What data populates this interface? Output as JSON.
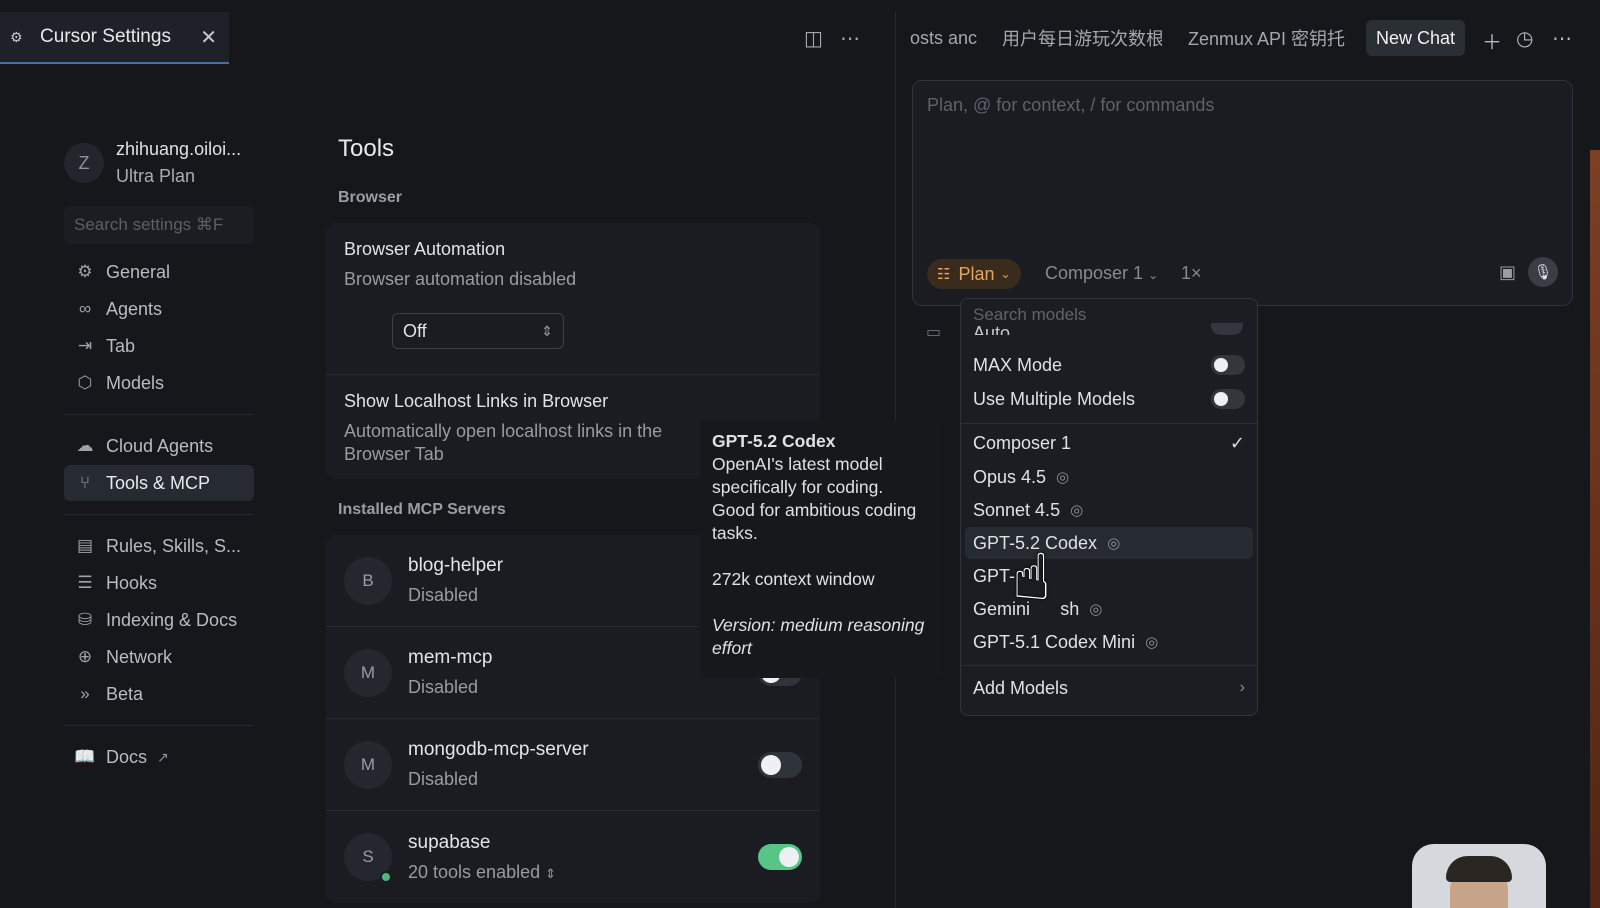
{
  "settings_tab": {
    "title": "Cursor Settings"
  },
  "user": {
    "initial": "Z",
    "name": "zhihuang.oiloi...",
    "plan": "Ultra Plan"
  },
  "search": {
    "placeholder": "Search settings ⌘F"
  },
  "nav": {
    "group1": [
      {
        "label": "General",
        "icon": "gear-icon"
      },
      {
        "label": "Agents",
        "icon": "infinity-icon"
      },
      {
        "label": "Tab",
        "icon": "tab-arrow-icon"
      },
      {
        "label": "Models",
        "icon": "cube-icon"
      }
    ],
    "group2": [
      {
        "label": "Cloud Agents",
        "icon": "cloud-icon"
      },
      {
        "label": "Tools & MCP",
        "icon": "tools-icon",
        "active": true
      }
    ],
    "group3": [
      {
        "label": "Rules, Skills, S...",
        "icon": "clipboard-icon"
      },
      {
        "label": "Hooks",
        "icon": "list-icon"
      },
      {
        "label": "Indexing & Docs",
        "icon": "database-icon"
      },
      {
        "label": "Network",
        "icon": "globe-icon"
      },
      {
        "label": "Beta",
        "icon": "chevrons-icon"
      }
    ],
    "group4": [
      {
        "label": "Docs",
        "icon": "book-icon"
      }
    ]
  },
  "main": {
    "title": "Tools",
    "browser_section": "Browser",
    "browser_automation": {
      "title": "Browser Automation",
      "subtitle": "Browser automation disabled",
      "select_value": "Off"
    },
    "localhost": {
      "title": "Show Localhost Links in Browser",
      "subtitle": "Automatically open localhost links in the Browser Tab"
    },
    "mcp_section": "Installed MCP Servers",
    "mcp_servers": [
      {
        "initial": "B",
        "name": "blog-helper",
        "status": "Disabled",
        "enabled": false
      },
      {
        "initial": "M",
        "name": "mem-mcp",
        "status": "Disabled",
        "enabled": false
      },
      {
        "initial": "M",
        "name": "mongodb-mcp-server",
        "status": "Disabled",
        "enabled": false
      },
      {
        "initial": "S",
        "name": "supabase",
        "status": "20 tools enabled",
        "enabled": true
      }
    ]
  },
  "tooltip": {
    "title": "GPT-5.2 Codex",
    "description": "OpenAI's latest model specifically for coding. Good for ambitious coding tasks.",
    "context": "272k context window",
    "version": "Version: medium reasoning effort"
  },
  "chat": {
    "tabs": [
      "osts anc",
      "用户每日游玩次数根",
      "Zenmux API 密钥托",
      "New Chat"
    ],
    "placeholder": "Plan, @ for context, / for commands",
    "mode": "Plan",
    "model": "Composer 1",
    "speed": "1×"
  },
  "dropdown": {
    "search_placeholder": "Search models",
    "cut_item": "Auto",
    "toggles": [
      {
        "label": "MAX Mode",
        "on": false
      },
      {
        "label": "Use Multiple Models",
        "on": false
      }
    ],
    "models": [
      {
        "label": "Composer 1",
        "selected": true,
        "thinking": false
      },
      {
        "label": "Opus 4.5",
        "thinking": true
      },
      {
        "label": "Sonnet 4.5",
        "thinking": true
      },
      {
        "label": "GPT-5.2 Codex",
        "thinking": true,
        "hover": true
      },
      {
        "label": "GPT-",
        "thinking": false
      },
      {
        "label": "Gemini        sh",
        "thinking": true
      },
      {
        "label": "GPT-5.1 Codex Mini",
        "thinking": true
      }
    ],
    "add_models": "Add Models"
  }
}
